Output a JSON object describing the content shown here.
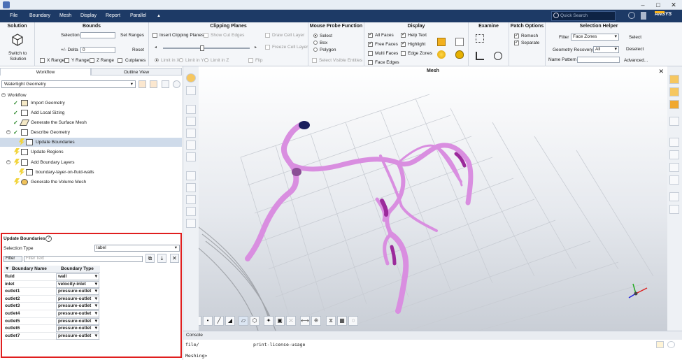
{
  "window": {
    "minimize": "–",
    "maximize": "□",
    "close": "✕"
  },
  "menu": {
    "items": [
      "File",
      "Boundary",
      "Mesh",
      "Display",
      "Report",
      "Parallel",
      "▲"
    ],
    "quick_search_placeholder": "Quick Search",
    "brand": "ANSYS"
  },
  "ribbon": {
    "solution": {
      "title": "Solution",
      "switch_label_1": "Switch to",
      "switch_label_2": "Solution"
    },
    "bounds": {
      "title": "Bounds",
      "selection_label": "Selection",
      "set_ranges": "Set Ranges",
      "delta_label": "+/- Delta",
      "delta_value": "0",
      "reset": "Reset",
      "x_range": "X Range",
      "y_range": "Y Range",
      "z_range": "Z Range",
      "cutplanes": "Cutplanes"
    },
    "clipping": {
      "title": "Clipping Planes",
      "insert": "Insert Clipping Planes",
      "show_cut_edges": "Show Cut Edges",
      "limit_x": "Limit in X",
      "limit_y": "Limit in Y",
      "limit_z": "Limit in Z",
      "draw_cell_layer": "Draw Cell Layer",
      "freeze_cell_layer": "Freeze Cell Layer",
      "flip": "Flip",
      "slider_fraction": 0.45
    },
    "probe": {
      "title": "Mouse Probe Function",
      "select": "Select",
      "box": "Box",
      "polygon": "Polygon",
      "select_visible": "Select Visible Entities"
    },
    "display": {
      "title": "Display",
      "all_faces": "All Faces",
      "free_faces": "Free Faces",
      "multi_faces": "Multi Faces",
      "face_edges": "Face Edges",
      "help_text": "Help Text",
      "highlight": "Highlight",
      "edge_zones": "Edge Zones"
    },
    "examine": {
      "title": "Examine"
    },
    "patch": {
      "title": "Patch Options",
      "remesh": "Remesh",
      "separate": "Separate"
    },
    "helper": {
      "title": "Selection Helper",
      "filter_label": "Filter",
      "filter_value": "Face Zones",
      "select": "Select",
      "recovery_label": "Geometry Recovery",
      "recovery_value": "All",
      "deselect": "Deselect",
      "pattern_label": "Name Pattern",
      "advanced": "Advanced..."
    }
  },
  "left": {
    "tabs": [
      "Workflow",
      "Outline View"
    ],
    "workflow_type": "Watertight Geometry",
    "tree": [
      "Workflow",
      "Import Geometry",
      "Add Local Sizing",
      "Generate the Surface Mesh",
      "Describe Geometry",
      "Update Boundaries",
      "Update Regions",
      "Add Boundary Layers",
      "boundary-layer-on-fluid-walls",
      "Generate the Volume Mesh"
    ]
  },
  "update_boundaries": {
    "title": "Update Boundaries",
    "info": "?",
    "selection_type_label": "Selection Type",
    "selection_type_value": "label",
    "filter_button": "Filter",
    "filter_placeholder": "Filter Text",
    "col_name": "Boundary Name",
    "col_type": "Boundary Type",
    "rows": [
      {
        "name": "fluid",
        "type": "wall"
      },
      {
        "name": "inlet",
        "type": "velocity-inlet"
      },
      {
        "name": "outlet1",
        "type": "pressure-outlet"
      },
      {
        "name": "outlet2",
        "type": "pressure-outlet"
      },
      {
        "name": "outlet3",
        "type": "pressure-outlet"
      },
      {
        "name": "outlet4",
        "type": "pressure-outlet"
      },
      {
        "name": "outlet5",
        "type": "pressure-outlet"
      },
      {
        "name": "outlet6",
        "type": "pressure-outlet"
      },
      {
        "name": "outlet7",
        "type": "pressure-outlet"
      }
    ]
  },
  "viewport": {
    "title": "Mesh",
    "close": "✕",
    "vessel_color": "#d98ee0",
    "outlet_color": "#9b2a9b"
  },
  "console": {
    "title": "Console",
    "line1_cmd": "file/",
    "line1_arg": "print-license-usage",
    "prompt": "Meshing>"
  }
}
